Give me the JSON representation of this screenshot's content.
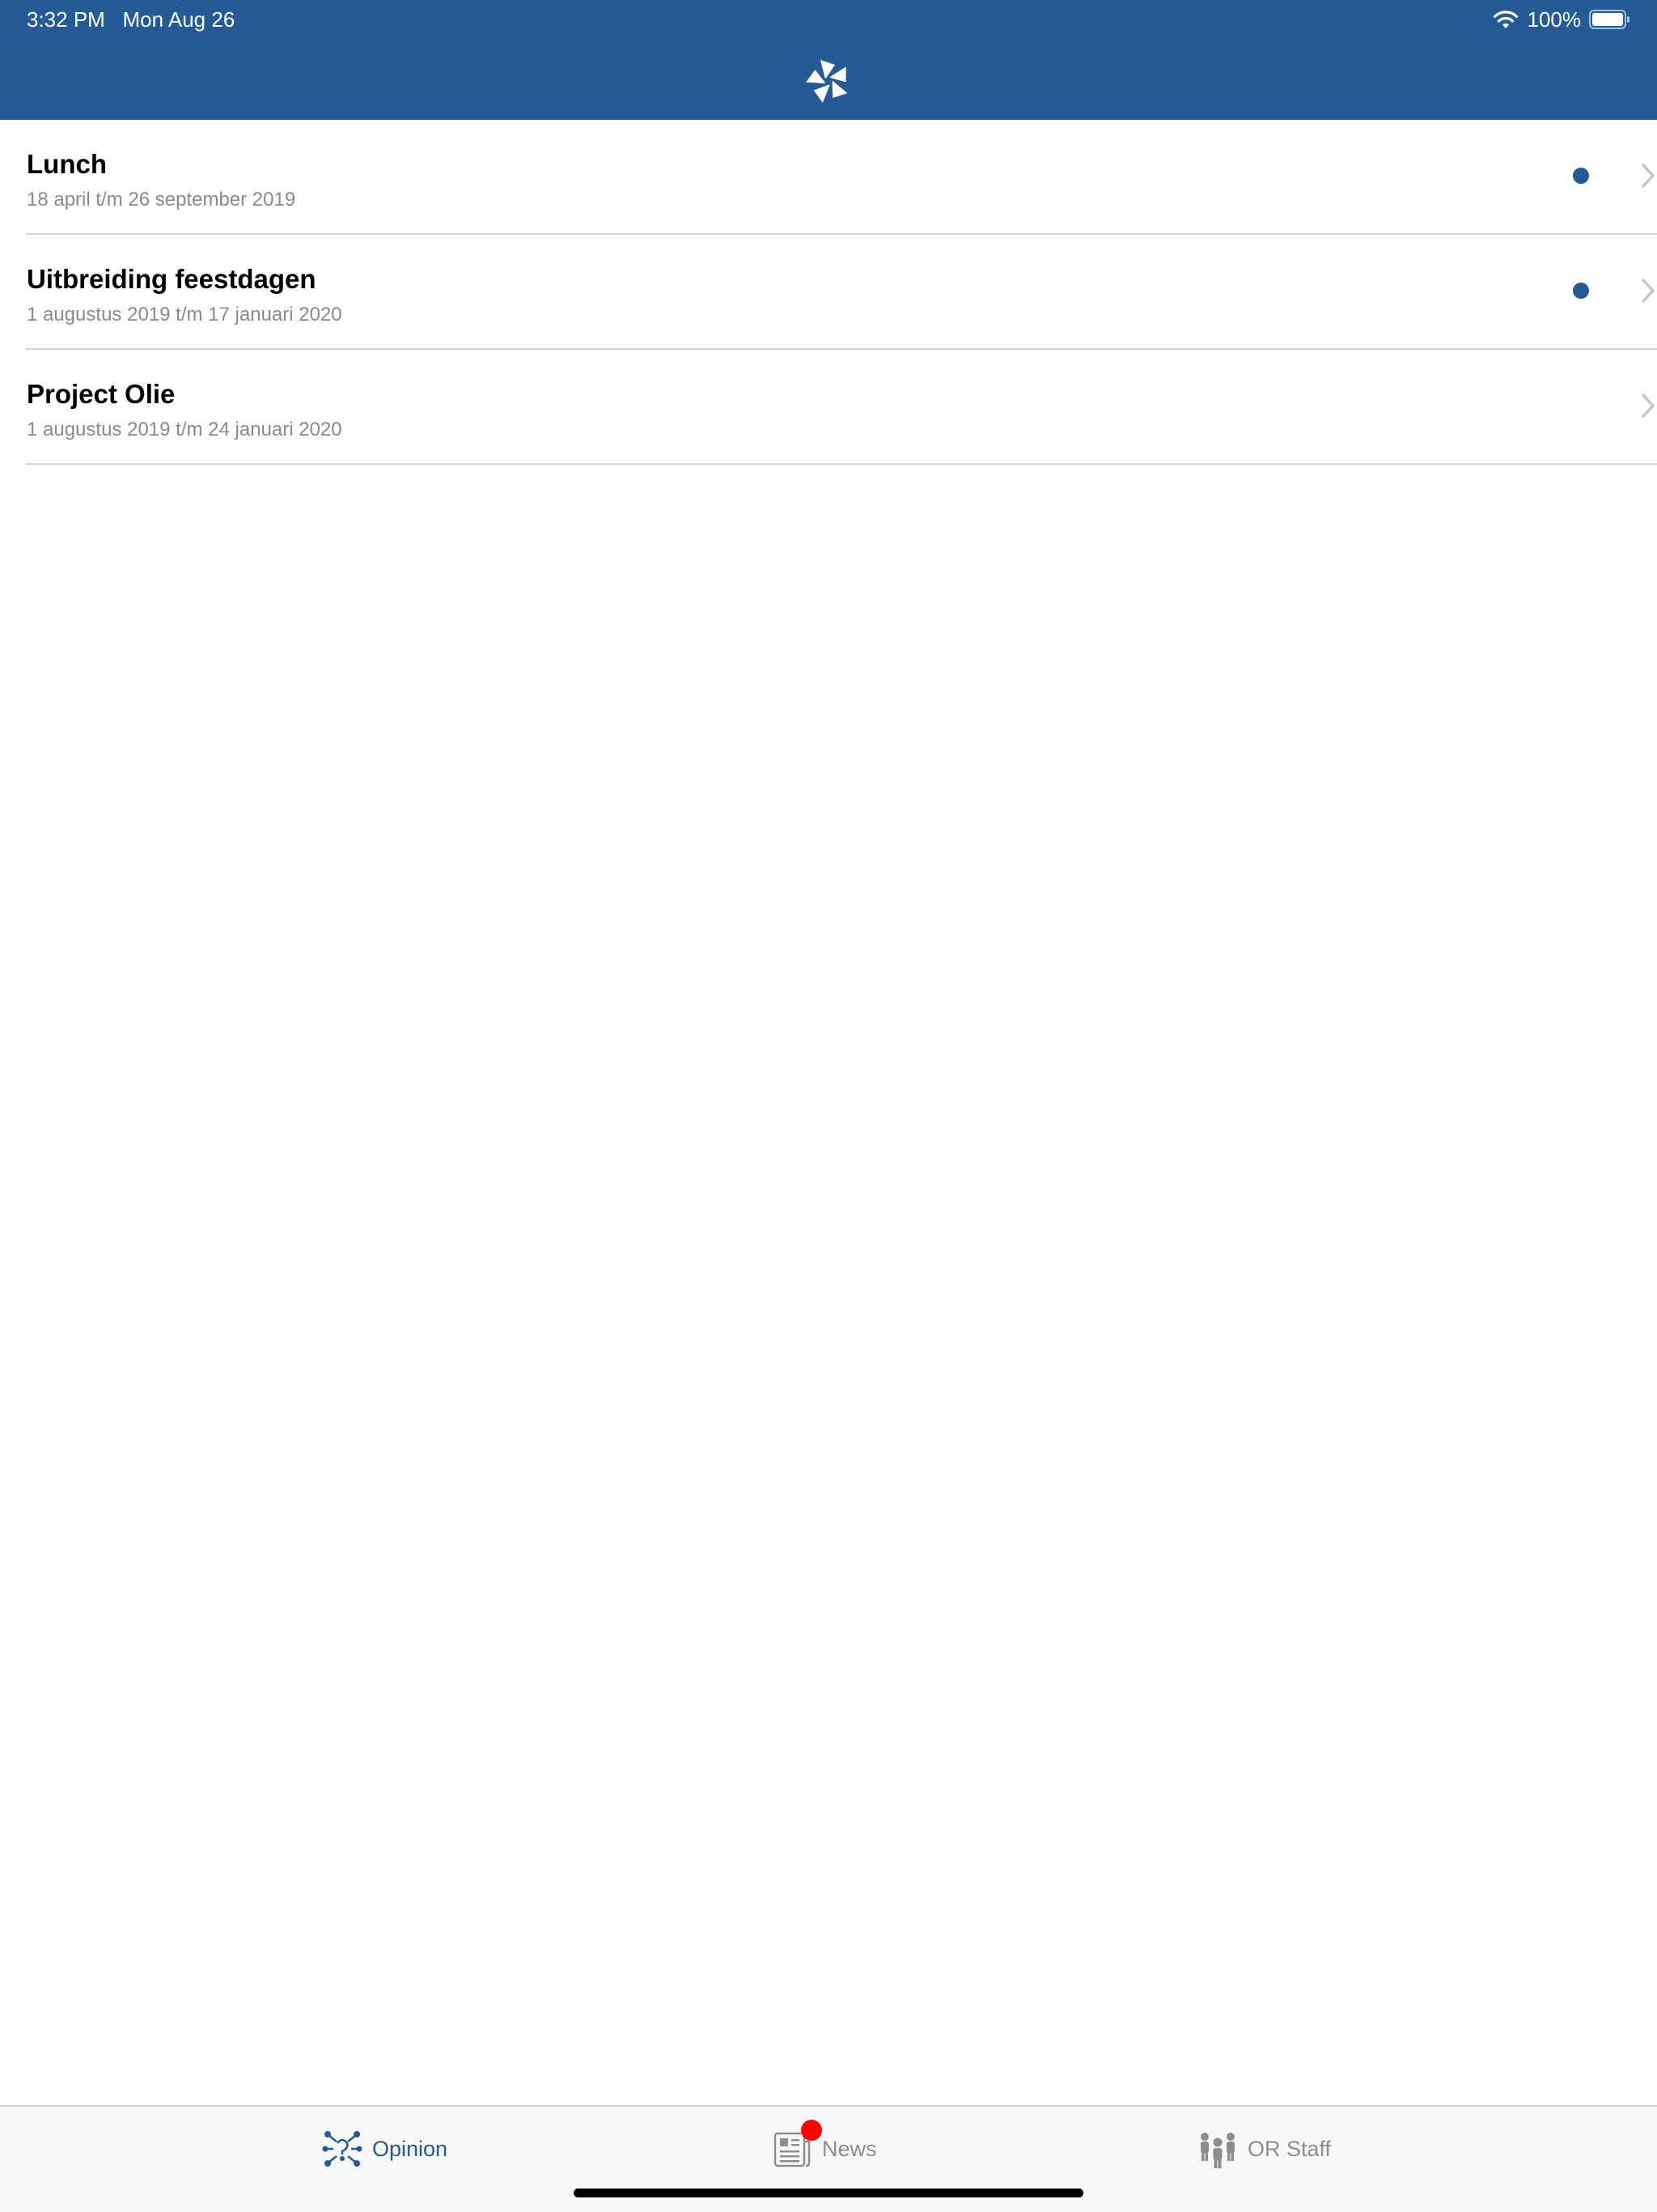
{
  "status_bar": {
    "time": "3:32 PM",
    "date": "Mon Aug 26",
    "battery": "100%"
  },
  "header": {
    "logo_icon": "flower-logo-icon",
    "background_color": "#255a96"
  },
  "items": [
    {
      "title": "Lunch",
      "subtitle": "18 april t/m 26 september 2019",
      "unread": true
    },
    {
      "title": "Uitbreiding feestdagen",
      "subtitle": "1 augustus 2019 t/m 17 januari 2020",
      "unread": true
    },
    {
      "title": "Project Olie",
      "subtitle": "1 augustus 2019 t/m 24 januari 2020",
      "unread": false
    }
  ],
  "tabs": [
    {
      "label": "Opinion",
      "icon": "opinion-network-icon",
      "selected": true
    },
    {
      "label": "News",
      "icon": "newspaper-icon",
      "selected": false,
      "badge": true
    },
    {
      "label": "OR Staff",
      "icon": "people-group-icon",
      "selected": false
    }
  ],
  "colors": {
    "accent": "#255a96",
    "badge": "#ff0000",
    "inactive": "#8e8e8e"
  }
}
